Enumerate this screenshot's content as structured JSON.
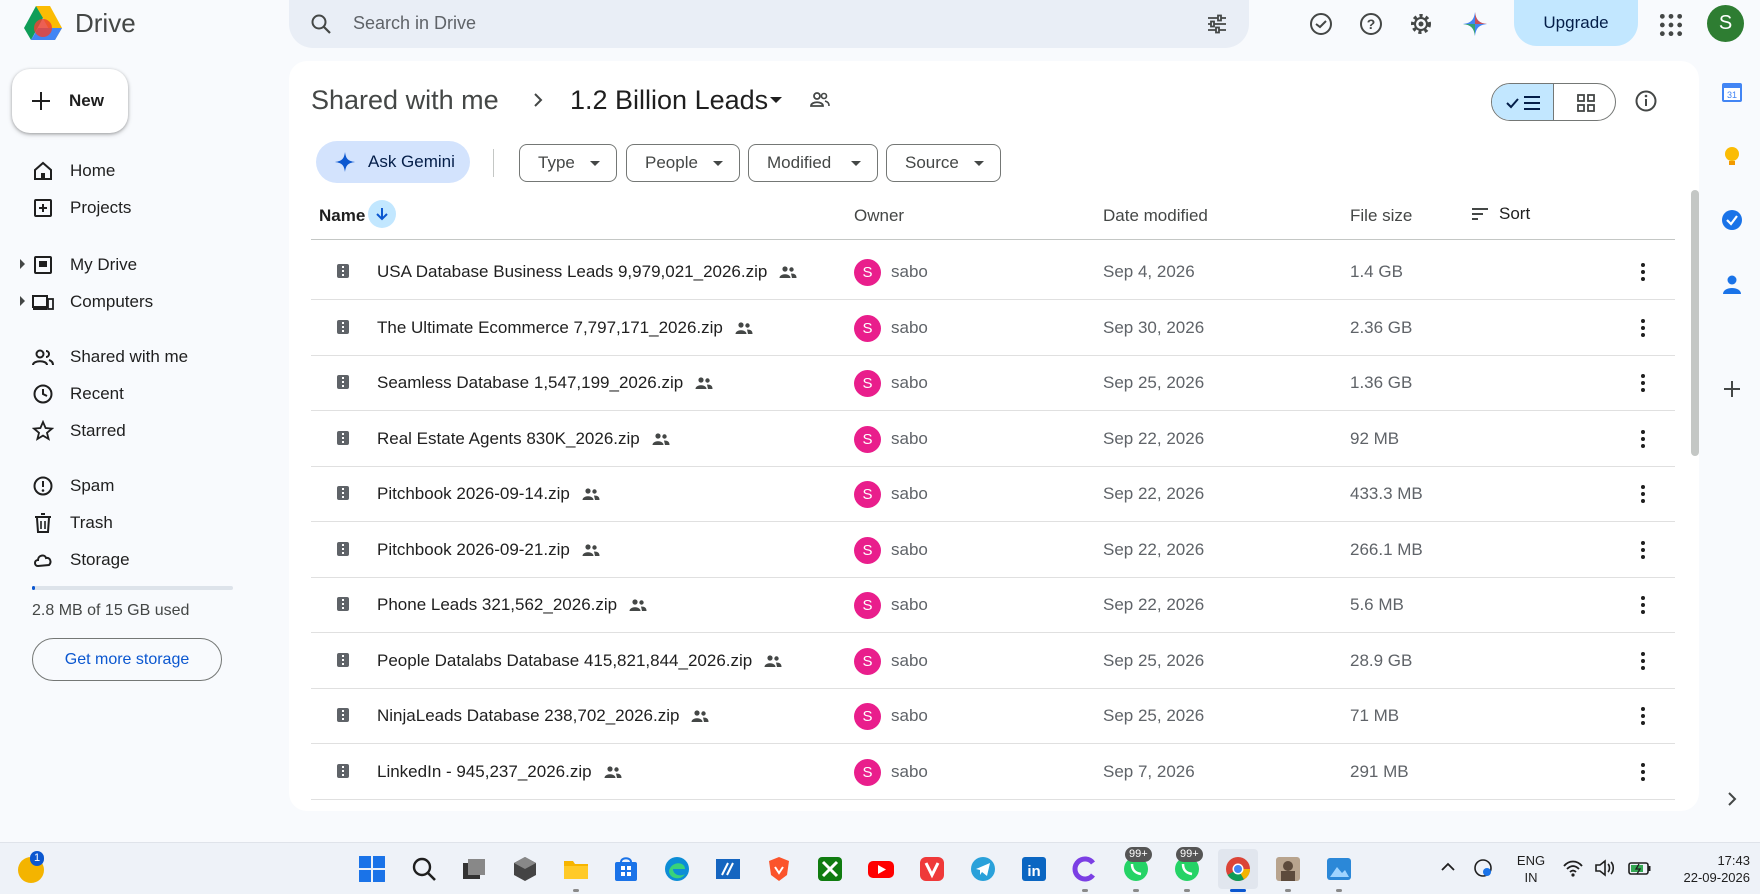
{
  "app": {
    "name": "Drive"
  },
  "search": {
    "placeholder": "Search in Drive"
  },
  "header": {
    "upgrade_label": "Upgrade",
    "avatar_initial": "S"
  },
  "sidebar": {
    "new_label": "New",
    "items": [
      {
        "label": "Home",
        "icon": "home-icon"
      },
      {
        "label": "Projects",
        "icon": "projects-icon"
      },
      {
        "label": "My Drive",
        "icon": "my-drive-icon"
      },
      {
        "label": "Computers",
        "icon": "computers-icon"
      },
      {
        "label": "Shared with me",
        "icon": "shared-icon"
      },
      {
        "label": "Recent",
        "icon": "clock-icon"
      },
      {
        "label": "Starred",
        "icon": "star-icon"
      },
      {
        "label": "Spam",
        "icon": "spam-icon"
      },
      {
        "label": "Trash",
        "icon": "trash-icon"
      },
      {
        "label": "Storage",
        "icon": "cloud-icon"
      }
    ],
    "storage_used_fraction": 0.0002,
    "storage_text": "2.8 MB of 15 GB used",
    "get_storage_label": "Get more storage"
  },
  "breadcrumb": {
    "parent": "Shared with me",
    "current": "1.2 Billion Leads"
  },
  "filters": {
    "ask_gemini": "Ask Gemini",
    "chips": [
      "Type",
      "People",
      "Modified",
      "Source"
    ]
  },
  "table": {
    "columns": {
      "name": "Name",
      "owner": "Owner",
      "date": "Date modified",
      "size": "File size",
      "sort": "Sort"
    },
    "rows": [
      {
        "name": "USA Database Business Leads 9,979,021_2026.zip",
        "owner_initial": "S",
        "owner": "sabo",
        "date": "Sep 4, 2026",
        "size": "1.4 GB"
      },
      {
        "name": "The Ultimate Ecommerce 7,797,171_2026.zip",
        "owner_initial": "S",
        "owner": "sabo",
        "date": "Sep 30, 2026",
        "size": "2.36 GB"
      },
      {
        "name": "Seamless Database 1,547,199_2026.zip",
        "owner_initial": "S",
        "owner": "sabo",
        "date": "Sep 25, 2026",
        "size": "1.36 GB"
      },
      {
        "name": "Real Estate Agents 830K_2026.zip",
        "owner_initial": "S",
        "owner": "sabo",
        "date": "Sep 22, 2026",
        "size": "92 MB"
      },
      {
        "name": "Pitchbook 2026-09-14.zip",
        "owner_initial": "S",
        "owner": "sabo",
        "date": "Sep 22, 2026",
        "size": "433.3 MB"
      },
      {
        "name": "Pitchbook 2026-09-21.zip",
        "owner_initial": "S",
        "owner": "sabo",
        "date": "Sep 22, 2026",
        "size": "266.1 MB"
      },
      {
        "name": "Phone Leads 321,562_2026.zip",
        "owner_initial": "S",
        "owner": "sabo",
        "date": "Sep 22, 2026",
        "size": "5.6 MB"
      },
      {
        "name": "People Datalabs Database 415,821,844_2026.zip",
        "owner_initial": "S",
        "owner": "sabo",
        "date": "Sep 25, 2026",
        "size": "28.9 GB"
      },
      {
        "name": "NinjaLeads Database 238,702_2026.zip",
        "owner_initial": "S",
        "owner": "sabo",
        "date": "Sep 25, 2026",
        "size": "71 MB"
      },
      {
        "name": "LinkedIn - 945,237_2026.zip",
        "owner_initial": "S",
        "owner": "sabo",
        "date": "Sep 7, 2026",
        "size": "291 MB"
      }
    ]
  },
  "rail": {
    "calendar_day": "31"
  },
  "taskbar": {
    "weather_badge": "1",
    "whatsapp_badge": "99+",
    "whatsapp2_badge": "99+",
    "lang": "ENG",
    "region": "IN",
    "time": "17:43",
    "date": "22-09-2026"
  },
  "colors": {
    "accent": "#0b57d0",
    "owner_avatar": "#e91e8c",
    "selected": "#c2e7ff"
  }
}
